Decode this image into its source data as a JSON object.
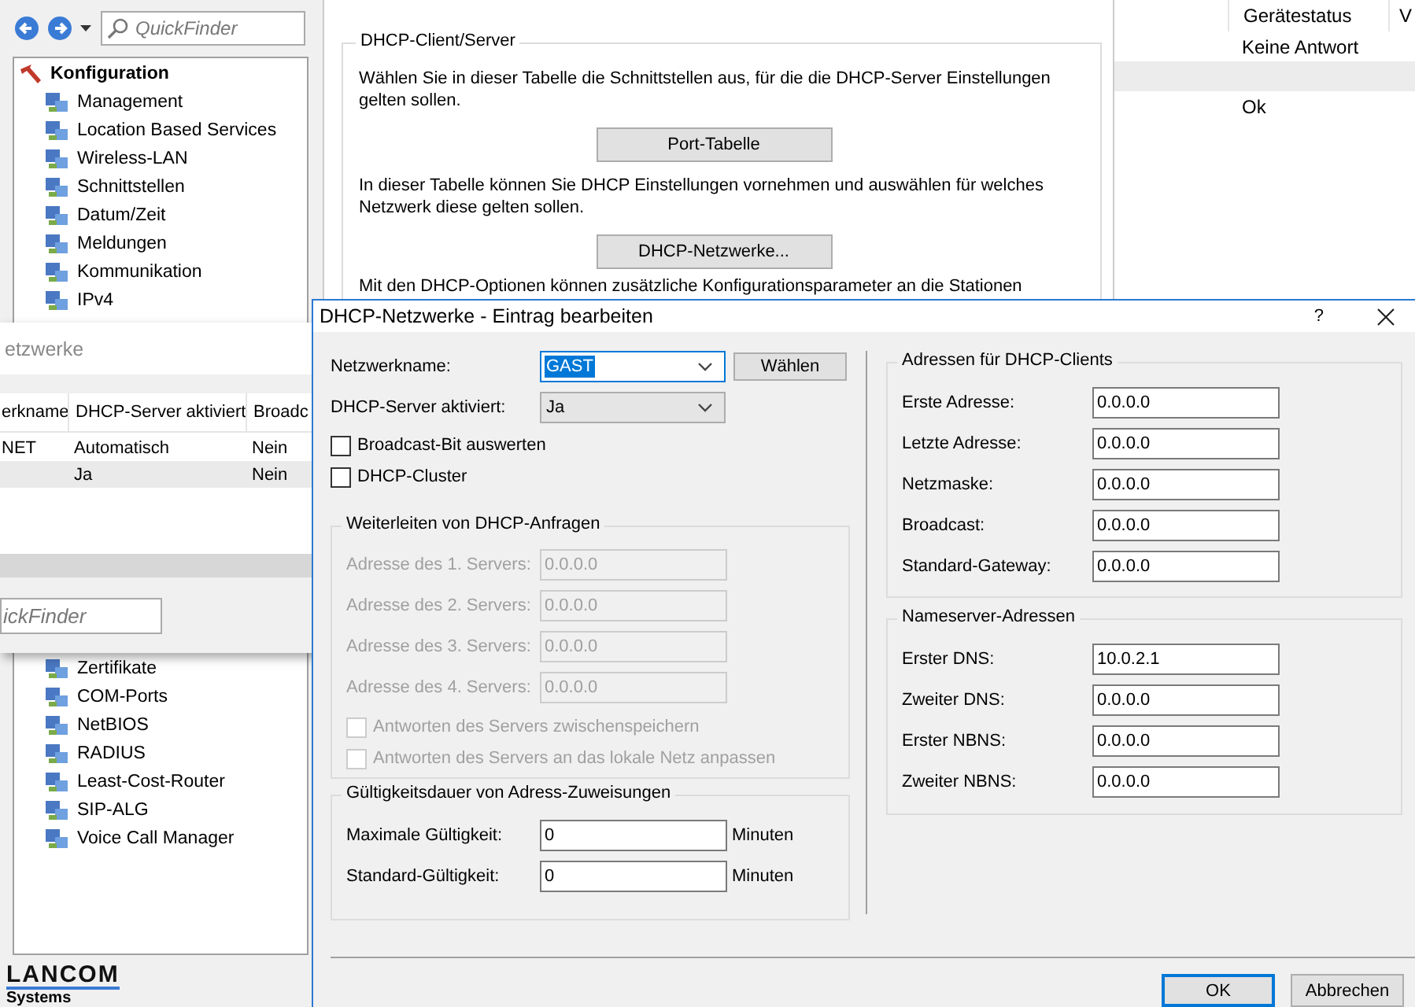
{
  "nav": {
    "quickfinder_placeholder": "QuickFinder"
  },
  "tree": {
    "label": "Konfiguration",
    "children": [
      {
        "label": "Management"
      },
      {
        "label": "Location Based Services"
      },
      {
        "label": "Wireless-LAN"
      },
      {
        "label": "Schnittstellen"
      },
      {
        "label": "Datum/Zeit"
      },
      {
        "label": "Meldungen"
      },
      {
        "label": "Kommunikation"
      },
      {
        "label": "IPv4"
      }
    ]
  },
  "tree_below_overlap": [
    {
      "label": "Zertifikate"
    },
    {
      "label": "COM-Ports"
    },
    {
      "label": "NetBIOS"
    },
    {
      "label": "RADIUS"
    },
    {
      "label": "Least-Cost-Router"
    },
    {
      "label": "SIP-ALG"
    },
    {
      "label": "Voice Call Manager"
    }
  ],
  "logo": {
    "name": "LANCOM",
    "tagline": "Systems"
  },
  "content": {
    "group_title": "DHCP-Client/Server",
    "blocks": [
      {
        "kind": "text",
        "text": "Wählen Sie in dieser Tabelle die Schnittstellen aus, für die die DHCP-Server Einstellungen gelten sollen."
      },
      {
        "kind": "button",
        "label": "Port-Tabelle"
      },
      {
        "kind": "text",
        "text": "In dieser Tabelle können Sie DHCP Einstellungen vornehmen und auswählen für welches Netzwerk diese gelten sollen."
      },
      {
        "kind": "button",
        "label": "DHCP-Netzwerke..."
      },
      {
        "kind": "text",
        "text": "Mit den DHCP-Optionen können zusätzliche Konfigurationsparameter an die Stationen"
      }
    ]
  },
  "status_pane": {
    "columns": [
      "Gerätestatus",
      "V"
    ],
    "rows": [
      {
        "status": "Keine Antwort",
        "selected": false
      },
      {
        "selected": true
      },
      {
        "status": "Ok",
        "selected": false
      }
    ]
  },
  "networks_window": {
    "title": "etzwerke",
    "columns": [
      "erkname",
      "DHCP-Server aktiviert",
      "Broadc"
    ],
    "rows": [
      {
        "column_1": "NET",
        "column_2": "Automatisch",
        "column_3": "Nein",
        "selected": false
      },
      {
        "column_2": "Ja",
        "column_3": "Nein",
        "selected": true
      }
    ],
    "quickfinder_placeholder": "ickFinder"
  },
  "dialog": {
    "title": "DHCP-Netzwerke - Eintrag bearbeiten",
    "help": "?",
    "network_name": {
      "label": "Netzwerkname:",
      "value": "GAST",
      "text_selected": true
    },
    "choose_button": "Wählen",
    "dhcp_server": {
      "label": "DHCP-Server aktiviert:",
      "value": "Ja"
    },
    "checkboxes": [
      {
        "label": "Broadcast-Bit auswerten",
        "checked": false
      },
      {
        "label": "DHCP-Cluster",
        "checked": false
      }
    ],
    "forwarding": {
      "title": "Weiterleiten von DHCP-Anfragen",
      "disabled": true,
      "servers": [
        {
          "label": "Adresse des 1. Servers:",
          "value": "0.0.0.0"
        },
        {
          "label": "Adresse des 2. Servers:",
          "value": "0.0.0.0"
        },
        {
          "label": "Adresse des 3. Servers:",
          "value": "0.0.0.0"
        },
        {
          "label": "Adresse des 4. Servers:",
          "value": "0.0.0.0"
        }
      ],
      "options": [
        {
          "label": "Antworten des Servers zwischenspeichern",
          "checked": false
        },
        {
          "label": "Antworten des Servers an das lokale Netz anpassen",
          "checked": false
        }
      ]
    },
    "lease": {
      "title": "Gültigkeitsdauer von Adress-Zuweisungen",
      "rows": [
        {
          "label": "Maximale Gültigkeit:",
          "value": "0",
          "unit": "Minuten"
        },
        {
          "label": "Standard-Gültigkeit:",
          "value": "0",
          "unit": "Minuten"
        }
      ]
    },
    "client_addresses": {
      "title": "Adressen für DHCP-Clients",
      "rows": [
        {
          "label": "Erste Adresse:",
          "value": "0.0.0.0"
        },
        {
          "label": "Letzte Adresse:",
          "value": "0.0.0.0"
        },
        {
          "label": "Netzmaske:",
          "value": "0.0.0.0"
        },
        {
          "label": "Broadcast:",
          "value": "0.0.0.0"
        },
        {
          "label": "Standard-Gateway:",
          "value": "0.0.0.0"
        }
      ]
    },
    "nameservers": {
      "title": "Nameserver-Adressen",
      "rows": [
        {
          "label": "Erster DNS:",
          "value": "10.0.2.1"
        },
        {
          "label": "Zweiter DNS:",
          "value": "0.0.0.0"
        },
        {
          "label": "Erster NBNS:",
          "value": "0.0.0.0"
        },
        {
          "label": "Zweiter NBNS:",
          "value": "0.0.0.0"
        }
      ]
    },
    "buttons": [
      {
        "label": "OK",
        "default": true
      },
      {
        "label": "Abbrechen",
        "default": false
      }
    ]
  }
}
